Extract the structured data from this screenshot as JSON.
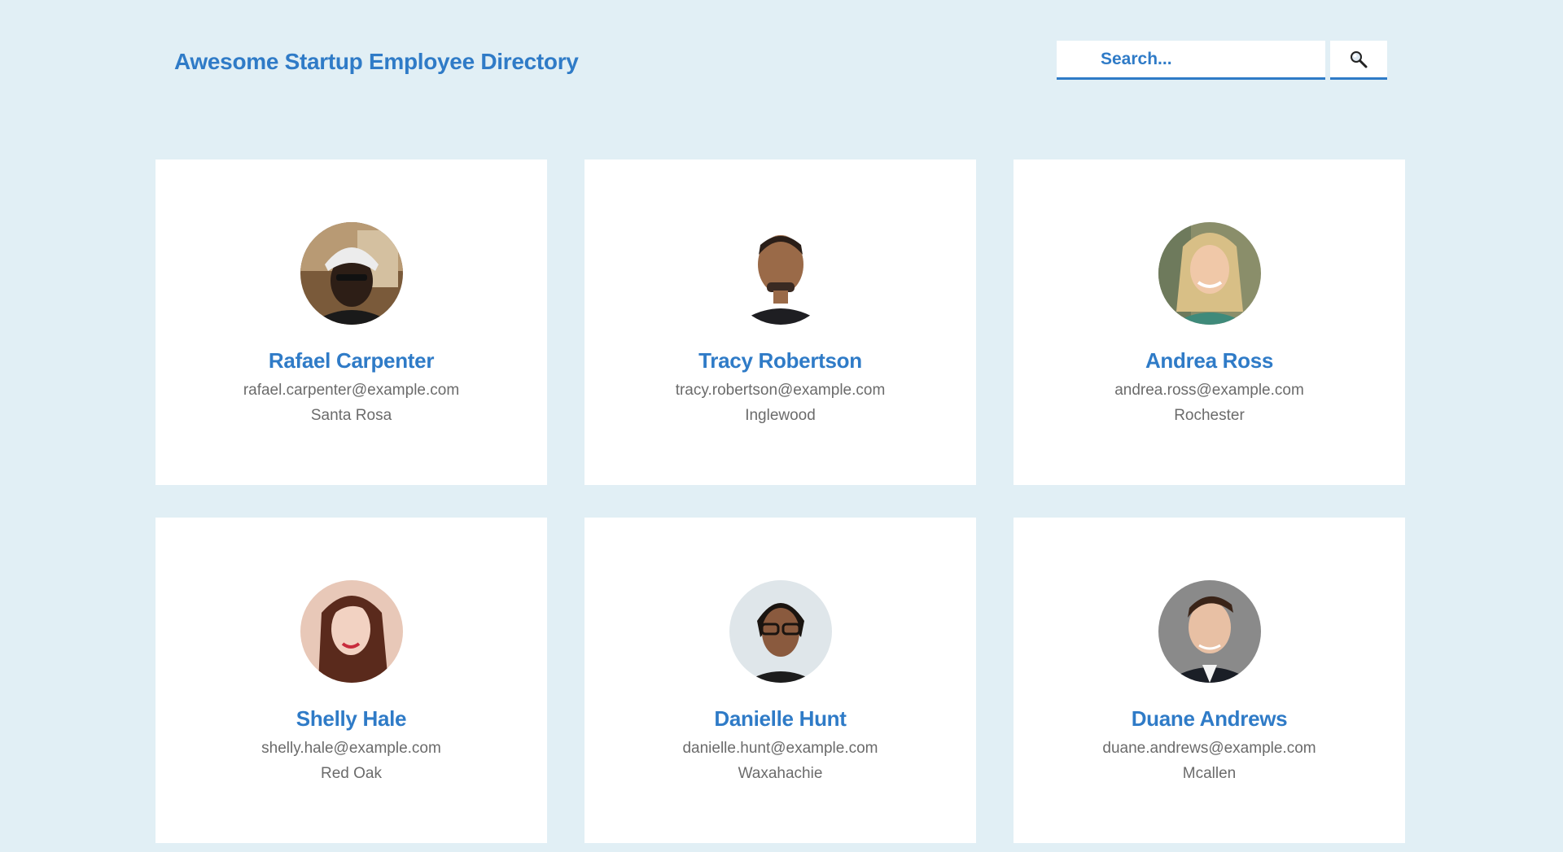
{
  "header": {
    "title": "Awesome Startup Employee Directory",
    "search_placeholder": "Search...",
    "search_button_icon": "magnifier-icon"
  },
  "colors": {
    "background": "#e1eff5",
    "accent": "#2f7bc7",
    "card": "#ffffff",
    "muted_text": "#6b6b6b"
  },
  "employees": [
    {
      "name": "Rafael Carpenter",
      "email": "rafael.carpenter@example.com",
      "city": "Santa Rosa",
      "avatar_icon": "employee-photo-icon"
    },
    {
      "name": "Tracy Robertson",
      "email": "tracy.robertson@example.com",
      "city": "Inglewood",
      "avatar_icon": "employee-photo-icon"
    },
    {
      "name": "Andrea Ross",
      "email": "andrea.ross@example.com",
      "city": "Rochester",
      "avatar_icon": "employee-photo-icon"
    },
    {
      "name": "Shelly Hale",
      "email": "shelly.hale@example.com",
      "city": "Red Oak",
      "avatar_icon": "employee-photo-icon"
    },
    {
      "name": "Danielle Hunt",
      "email": "danielle.hunt@example.com",
      "city": "Waxahachie",
      "avatar_icon": "employee-photo-icon"
    },
    {
      "name": "Duane Andrews",
      "email": "duane.andrews@example.com",
      "city": "Mcallen",
      "avatar_icon": "employee-photo-icon"
    }
  ]
}
